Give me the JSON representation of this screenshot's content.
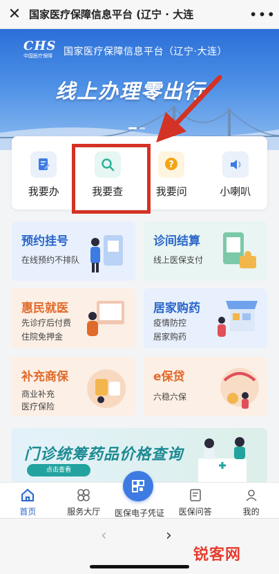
{
  "topbar": {
    "title": "国家医疗保障信息平台 (辽宁 · 大连",
    "close_icon": "close-icon",
    "more_icon": "more-icon"
  },
  "banner": {
    "logo": "CHS",
    "logo_sub": "中国医疗保障",
    "org": "国家医疗保障信息平台（辽宁·大连）",
    "slogan": "线上办理零出行"
  },
  "quick_menu": [
    {
      "label": "我要办",
      "icon": "edit-doc-icon"
    },
    {
      "label": "我要查",
      "icon": "search-icon"
    },
    {
      "label": "我要问",
      "icon": "question-icon"
    },
    {
      "label": "小喇叭",
      "icon": "speaker-icon"
    }
  ],
  "services": [
    {
      "title": "预约挂号",
      "lines": [
        "在线预约不排队"
      ]
    },
    {
      "title": "诊间结算",
      "lines": [
        "线上医保支付"
      ]
    },
    {
      "title": "惠民就医",
      "lines": [
        "先诊疗后付费",
        "住院免押金"
      ]
    },
    {
      "title": "居家购药",
      "lines": [
        "疫情防控",
        "居家购药"
      ]
    },
    {
      "title": "补充商保",
      "lines": [
        "商业补充",
        "医疗保险"
      ]
    },
    {
      "title": "e保贷",
      "lines": [
        "六稳六保"
      ]
    }
  ],
  "promo": {
    "title": "门诊统筹药品价格查询",
    "button": "点击查看"
  },
  "tabs": [
    {
      "label": "首页",
      "icon": "home-icon"
    },
    {
      "label": "服务大厅",
      "icon": "grid-icon"
    },
    {
      "label": "医保电子凭证",
      "icon": "qr-code-icon"
    },
    {
      "label": "医保问答",
      "icon": "scroll-icon"
    },
    {
      "label": "我的",
      "icon": "user-icon"
    }
  ],
  "watermark": "锐客网",
  "colors": {
    "primary": "#2a66c9",
    "highlight_box": "#d43224",
    "orange": "#e06a2a"
  }
}
